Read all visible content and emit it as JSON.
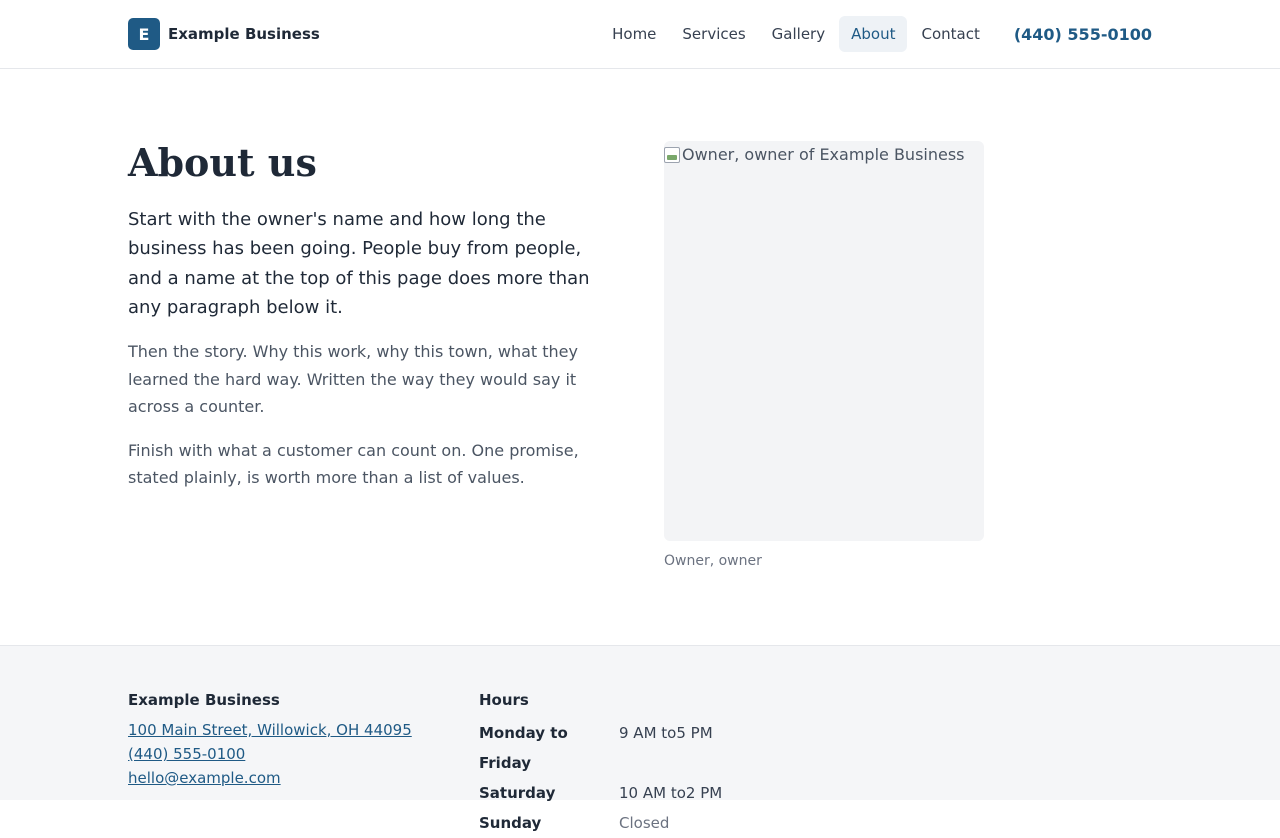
{
  "header": {
    "logo_letter": "E",
    "brand_name": "Example Business",
    "nav": [
      {
        "label": "Home"
      },
      {
        "label": "Services"
      },
      {
        "label": "Gallery"
      },
      {
        "label": "About"
      },
      {
        "label": "Contact"
      }
    ],
    "active_nav": "About",
    "phone": "(440) 555-0100"
  },
  "main": {
    "title": "About us",
    "lead": "Start with the owner's name and how long the business has been going. People buy from people, and a name at the top of this page does more than any paragraph below it.",
    "paragraphs": [
      "Then the story. Why this work, why this town, what they learned the hard way. Written the way they would say it across a counter.",
      "Finish with what a customer can count on. One promise, stated plainly, is worth more than a list of values."
    ],
    "photo_alt": "Owner, owner of Example Business",
    "photo_caption": "Owner, owner"
  },
  "footer": {
    "business_name": "Example Business",
    "address": "100 Main Street, Willowick, OH 44095",
    "phone": "(440) 555-0100",
    "email": "hello@example.com",
    "hours_heading": "Hours",
    "hours": [
      {
        "day": "Monday to Friday",
        "time": "9 AM to5 PM"
      },
      {
        "day": "Saturday",
        "time": "10 AM to2 PM"
      },
      {
        "day": "Sunday",
        "time": "Closed"
      }
    ]
  },
  "colors": {
    "brand": "#1f5a85",
    "text": "#1f2937",
    "muted": "#4b5563",
    "footer_bg": "#f5f6f8"
  },
  "icons": [
    "broken-image-icon"
  ]
}
